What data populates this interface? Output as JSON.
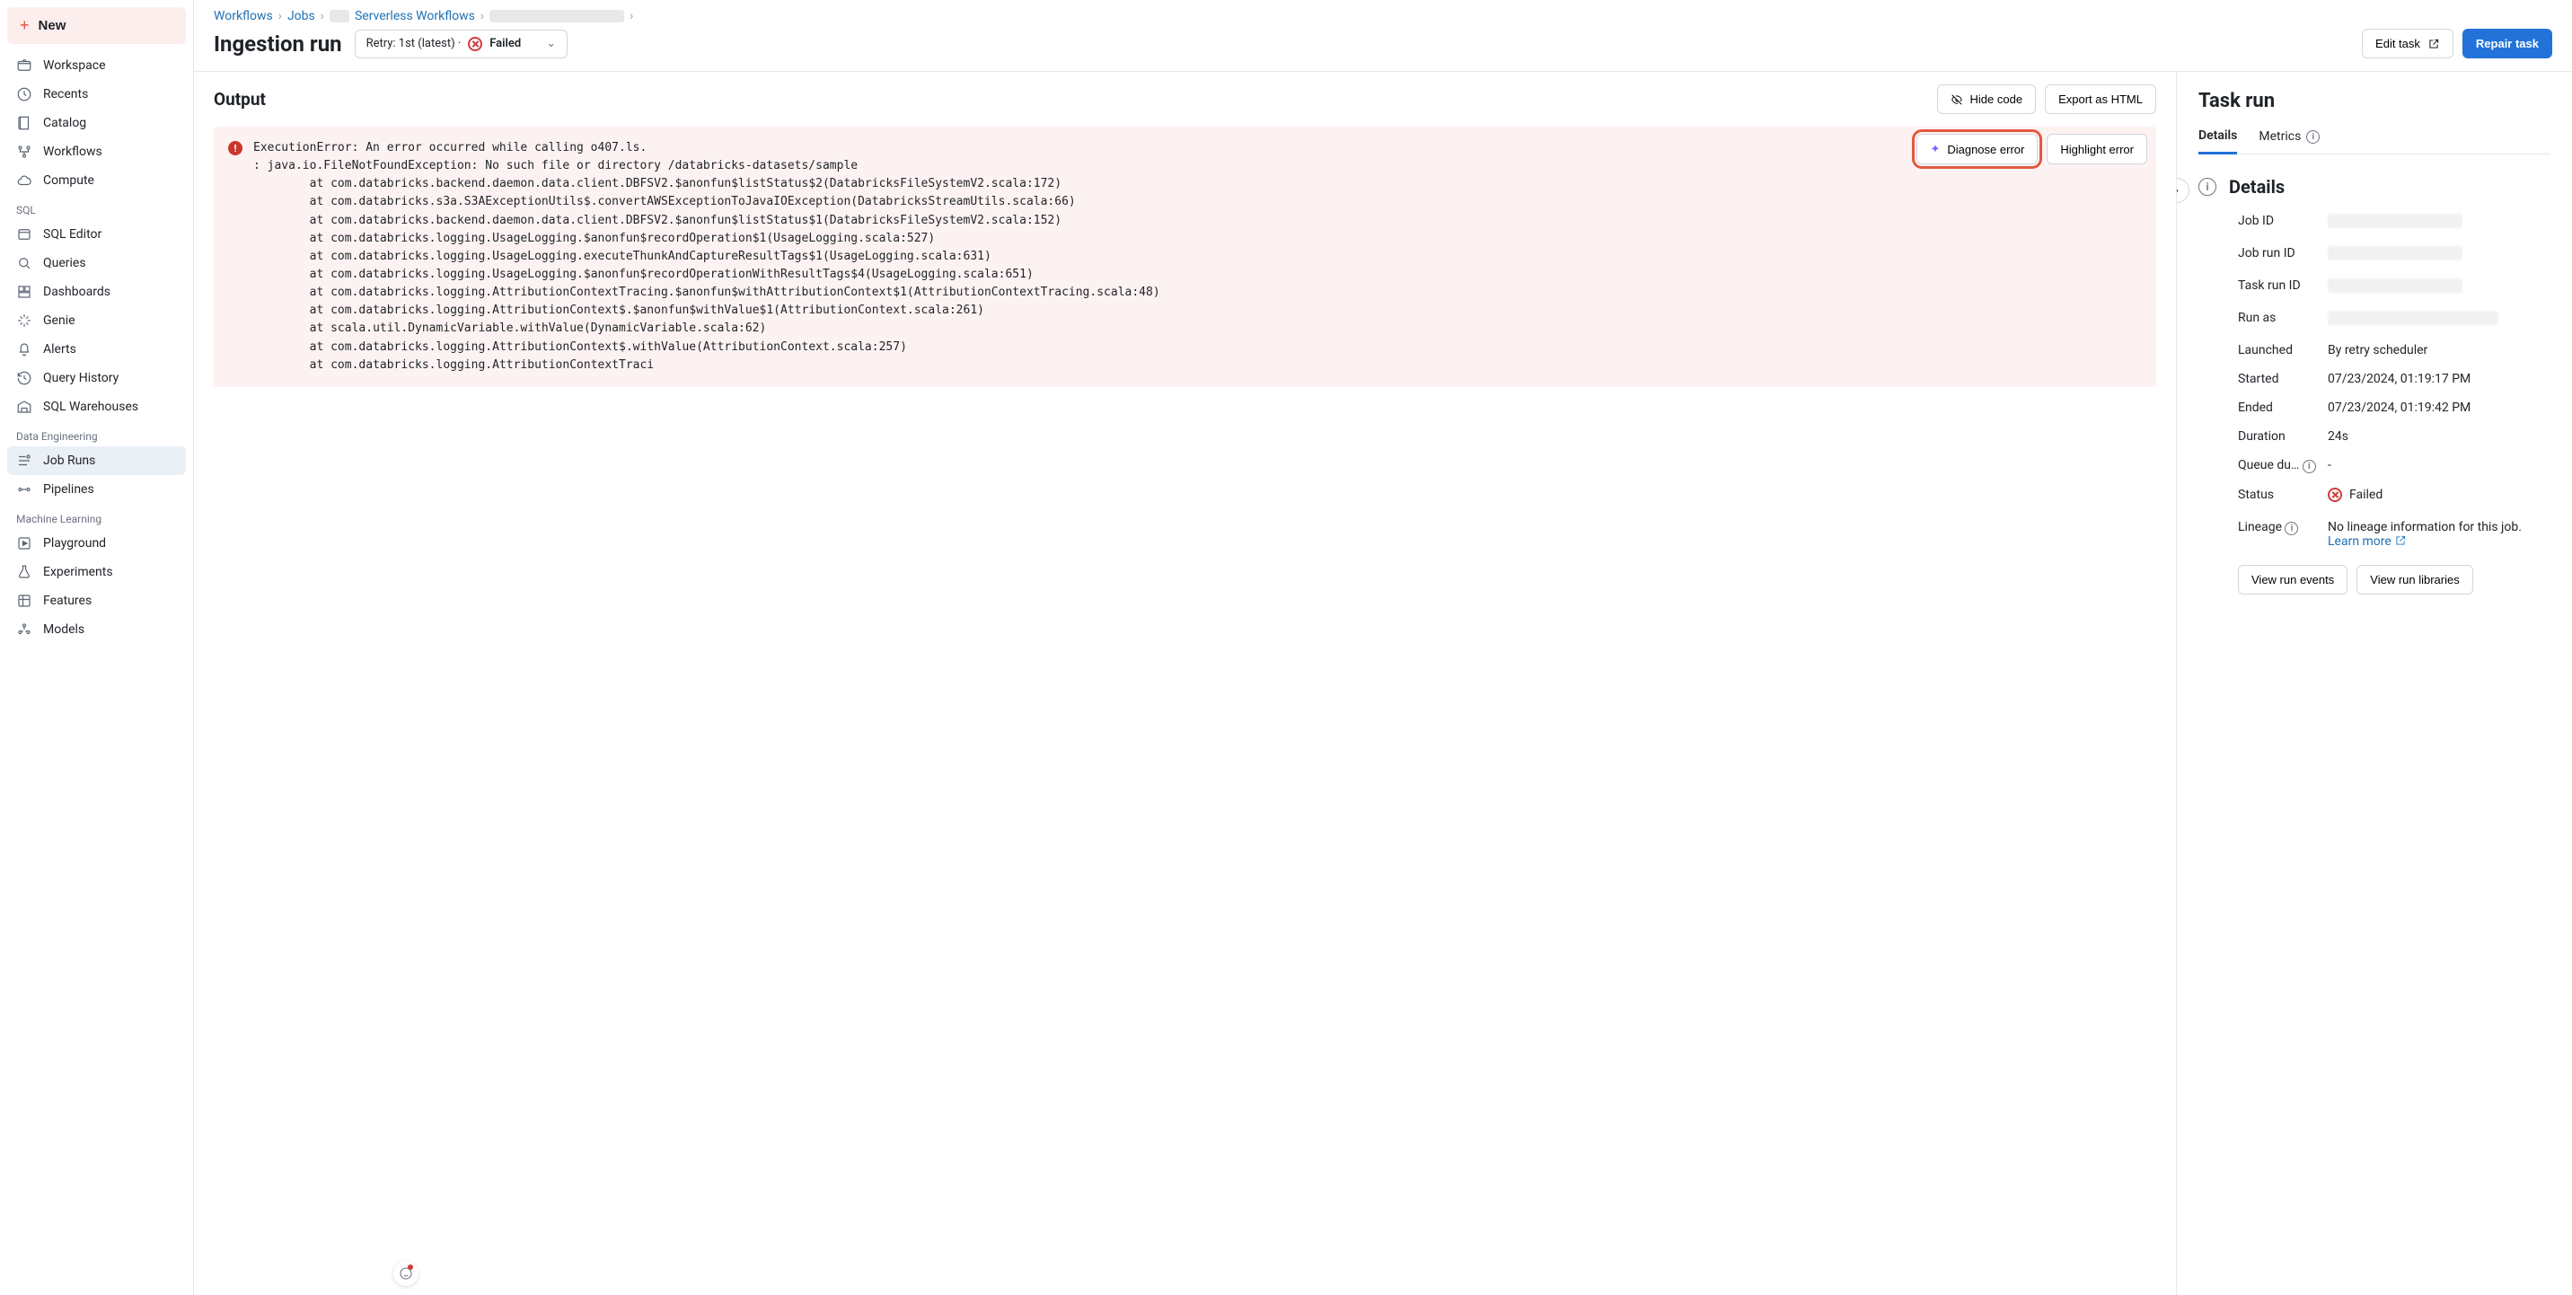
{
  "sidebar": {
    "new_label": "New",
    "groups": [
      {
        "items": [
          {
            "icon": "folder",
            "label": "Workspace"
          },
          {
            "icon": "clock",
            "label": "Recents"
          },
          {
            "icon": "book",
            "label": "Catalog"
          },
          {
            "icon": "flow",
            "label": "Workflows"
          },
          {
            "icon": "cloud",
            "label": "Compute"
          }
        ]
      },
      {
        "label": "SQL",
        "items": [
          {
            "icon": "sql",
            "label": "SQL Editor"
          },
          {
            "icon": "search",
            "label": "Queries"
          },
          {
            "icon": "dash",
            "label": "Dashboards"
          },
          {
            "icon": "sparkle",
            "label": "Genie"
          },
          {
            "icon": "bell",
            "label": "Alerts"
          },
          {
            "icon": "history",
            "label": "Query History"
          },
          {
            "icon": "warehouse",
            "label": "SQL Warehouses"
          }
        ]
      },
      {
        "label": "Data Engineering",
        "items": [
          {
            "icon": "runs",
            "label": "Job Runs",
            "active": true
          },
          {
            "icon": "pipeline",
            "label": "Pipelines"
          }
        ]
      },
      {
        "label": "Machine Learning",
        "items": [
          {
            "icon": "play",
            "label": "Playground"
          },
          {
            "icon": "flask",
            "label": "Experiments"
          },
          {
            "icon": "features",
            "label": "Features"
          },
          {
            "icon": "models",
            "label": "Models"
          }
        ]
      }
    ]
  },
  "breadcrumbs": {
    "items": [
      "Workflows",
      "Jobs",
      "Serverless Workflows",
      ""
    ]
  },
  "page": {
    "title": "Ingestion run",
    "retry_prefix": "Retry: 1st (latest) · ",
    "retry_status": "Failed",
    "edit_task": "Edit task",
    "repair_task": "Repair task"
  },
  "output": {
    "title": "Output",
    "hide_code": "Hide code",
    "export_html": "Export as HTML",
    "diagnose": "Diagnose error",
    "highlight": "Highlight error",
    "error_text": "ExecutionError: An error occurred while calling o407.ls.\n: java.io.FileNotFoundException: No such file or directory /databricks-datasets/sample\n        at com.databricks.backend.daemon.data.client.DBFSV2.$anonfun$listStatus$2(DatabricksFileSystemV2.scala:172)\n        at com.databricks.s3a.S3AExceptionUtils$.convertAWSExceptionToJavaIOException(DatabricksStreamUtils.scala:66)\n        at com.databricks.backend.daemon.data.client.DBFSV2.$anonfun$listStatus$1(DatabricksFileSystemV2.scala:152)\n        at com.databricks.logging.UsageLogging.$anonfun$recordOperation$1(UsageLogging.scala:527)\n        at com.databricks.logging.UsageLogging.executeThunkAndCaptureResultTags$1(UsageLogging.scala:631)\n        at com.databricks.logging.UsageLogging.$anonfun$recordOperationWithResultTags$4(UsageLogging.scala:651)\n        at com.databricks.logging.AttributionContextTracing.$anonfun$withAttributionContext$1(AttributionContextTracing.scala:48)\n        at com.databricks.logging.AttributionContext$.$anonfun$withValue$1(AttributionContext.scala:261)\n        at scala.util.DynamicVariable.withValue(DynamicVariable.scala:62)\n        at com.databricks.logging.AttributionContext$.withValue(AttributionContext.scala:257)\n        at com.databricks.logging.AttributionContextTraci"
  },
  "panel": {
    "title": "Task run",
    "tabs": {
      "details": "Details",
      "metrics": "Metrics"
    },
    "details_heading": "Details",
    "rows": {
      "job_id": {
        "k": "Job ID"
      },
      "job_run_id": {
        "k": "Job run ID"
      },
      "task_run_id": {
        "k": "Task run ID"
      },
      "run_as": {
        "k": "Run as"
      },
      "launched": {
        "k": "Launched",
        "v": "By retry scheduler"
      },
      "started": {
        "k": "Started",
        "v": "07/23/2024, 01:19:17 PM"
      },
      "ended": {
        "k": "Ended",
        "v": "07/23/2024, 01:19:42 PM"
      },
      "duration": {
        "k": "Duration",
        "v": "24s"
      },
      "queue": {
        "k": "Queue du…",
        "v": "-"
      },
      "status": {
        "k": "Status",
        "v": "Failed"
      },
      "lineage": {
        "k": "Lineage",
        "v": "No lineage information for this job.",
        "learn": "Learn more"
      }
    },
    "view_events": "View run events",
    "view_libs": "View run libraries"
  }
}
